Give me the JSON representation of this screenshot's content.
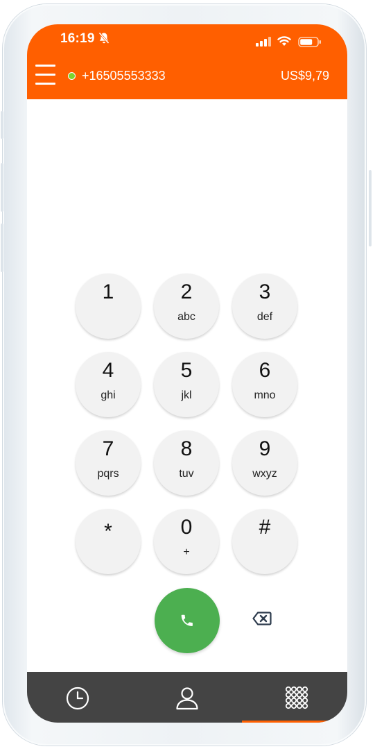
{
  "status_bar": {
    "time": "16:19",
    "icons": [
      "bell-muted-icon",
      "signal-icon",
      "wifi-icon",
      "battery-icon"
    ]
  },
  "header": {
    "menu_icon": "hamburger-menu-icon",
    "online_status_color": "#7bd42f",
    "phone_number": "+16505553333",
    "balance": "US$9,79"
  },
  "keypad": {
    "keys": [
      {
        "digit": "1",
        "letters": ""
      },
      {
        "digit": "2",
        "letters": "abc"
      },
      {
        "digit": "3",
        "letters": "def"
      },
      {
        "digit": "4",
        "letters": "ghi"
      },
      {
        "digit": "5",
        "letters": "jkl"
      },
      {
        "digit": "6",
        "letters": "mno"
      },
      {
        "digit": "7",
        "letters": "pqrs"
      },
      {
        "digit": "8",
        "letters": "tuv"
      },
      {
        "digit": "9",
        "letters": "wxyz"
      },
      {
        "digit": "*",
        "letters": ""
      },
      {
        "digit": "0",
        "letters": "+"
      },
      {
        "digit": "#",
        "letters": ""
      }
    ],
    "call_icon": "phone-call-icon",
    "backspace_icon": "backspace-icon"
  },
  "bottom_nav": {
    "items": [
      {
        "icon": "history-clock-icon",
        "active": false
      },
      {
        "icon": "contacts-person-icon",
        "active": false
      },
      {
        "icon": "dialpad-grid-icon",
        "active": true
      }
    ]
  },
  "colors": {
    "brand": "#ff5f00",
    "call_button": "#4caf50",
    "key_background": "#f2f2f2",
    "nav_background": "#444444"
  }
}
